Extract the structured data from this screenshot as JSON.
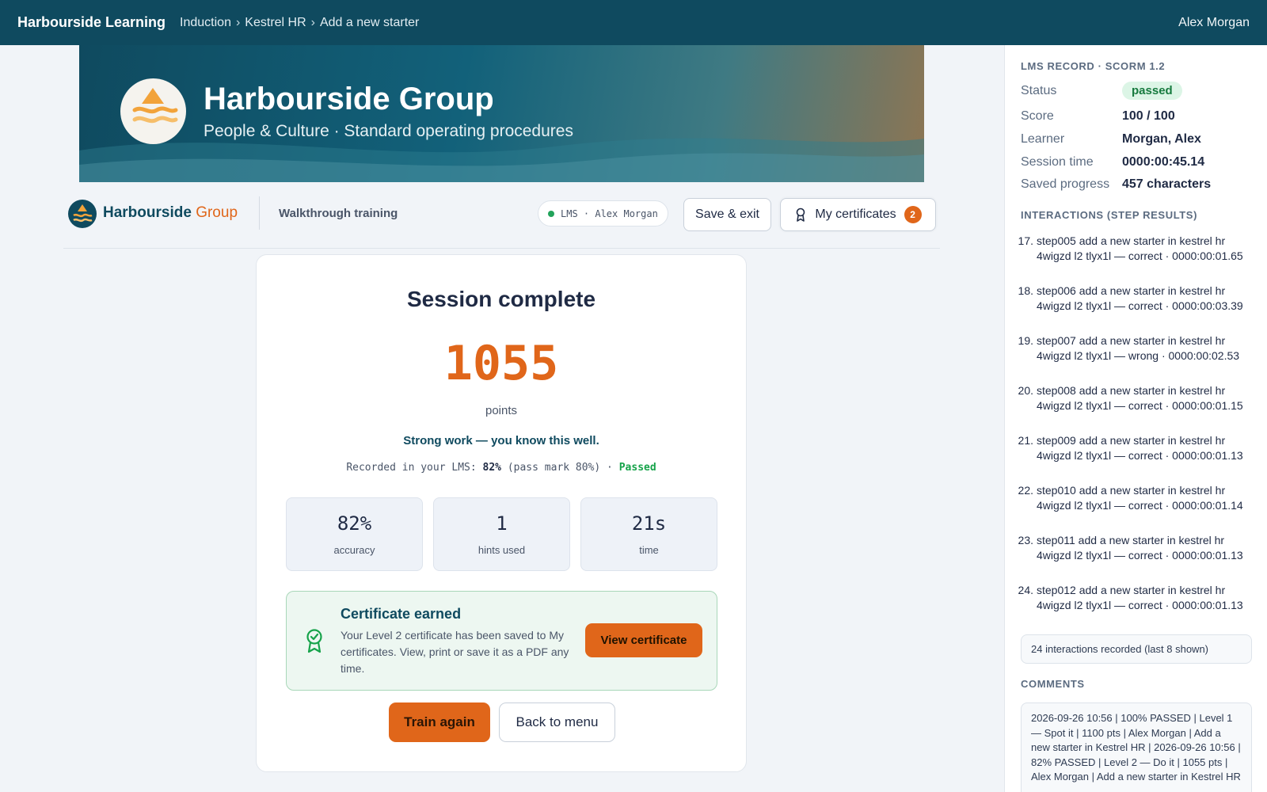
{
  "topbar": {
    "brand": "Harbourside Learning",
    "crumbs": [
      "Induction",
      "Kestrel HR",
      "Add a new starter"
    ],
    "separator": "›",
    "user": "Alex Morgan"
  },
  "hero": {
    "title": "Harbourside Group",
    "subtitle": "People & Culture · Standard operating procedures"
  },
  "apphead": {
    "brand_main": "Harbourside",
    "brand_accent": "Group",
    "section": "Walkthrough training",
    "lms_pill": "LMS · Alex Morgan",
    "save_label": "Save & exit",
    "certs_label": "My certificates",
    "certs_count": "2"
  },
  "session": {
    "heading": "Session complete",
    "points": "1055",
    "points_label": "points",
    "praise": "Strong work — you know this well.",
    "recorded_prefix": "Recorded in your LMS:",
    "recorded_score": "82%",
    "recorded_passmark": "(pass mark 80%) ·",
    "recorded_status": "Passed",
    "stats": [
      {
        "value": "82%",
        "label": "accuracy"
      },
      {
        "value": "1",
        "label": "hints used"
      },
      {
        "value": "21s",
        "label": "time"
      }
    ],
    "certificate": {
      "title": "Certificate earned",
      "text": "Your Level 2 certificate has been saved to My certificates. View, print or save it as a PDF any time.",
      "button": "View certificate"
    },
    "train_again": "Train again",
    "back_to_menu": "Back to menu"
  },
  "lms": {
    "heading": "LMS RECORD · SCORM 1.2",
    "status_label": "Status",
    "status": "passed",
    "score_label": "Score",
    "score": "100 / 100",
    "learner_label": "Learner",
    "learner": "Morgan, Alex",
    "session_time_label": "Session time",
    "session_time": "0000:00:45.14",
    "saved_label": "Saved progress",
    "saved": "457 characters",
    "interactions_heading": "INTERACTIONS (STEP RESULTS)",
    "interactions": [
      {
        "num": "17.",
        "text": "step005 add a new starter in kestrel hr 4wigzd l2 tlyx1l — correct · 0000:00:01.65"
      },
      {
        "num": "18.",
        "text": "step006 add a new starter in kestrel hr 4wigzd l2 tlyx1l — correct · 0000:00:03.39"
      },
      {
        "num": "19.",
        "text": "step007 add a new starter in kestrel hr 4wigzd l2 tlyx1l — wrong · 0000:00:02.53"
      },
      {
        "num": "20.",
        "text": "step008 add a new starter in kestrel hr 4wigzd l2 tlyx1l — correct · 0000:00:01.15"
      },
      {
        "num": "21.",
        "text": "step009 add a new starter in kestrel hr 4wigzd l2 tlyx1l — correct · 0000:00:01.13"
      },
      {
        "num": "22.",
        "text": "step010 add a new starter in kestrel hr 4wigzd l2 tlyx1l — correct · 0000:00:01.14"
      },
      {
        "num": "23.",
        "text": "step011 add a new starter in kestrel hr 4wigzd l2 tlyx1l — correct · 0000:00:01.13"
      },
      {
        "num": "24.",
        "text": "step012 add a new starter in kestrel hr 4wigzd l2 tlyx1l — correct · 0000:00:01.13"
      }
    ],
    "interactions_summary": "24 interactions recorded (last 8 shown)",
    "comments_heading": "COMMENTS",
    "comments": "2026-09-26 10:56 | 100% PASSED | Level 1 — Spot it | 1100 pts | Alex Morgan | Add a new starter in Kestrel HR | 2026-09-26 10:56 | 82% PASSED | Level 2 — Do it | 1055 pts | Alex Morgan | Add a new starter in Kestrel HR"
  },
  "colors": {
    "brand": "#0f4a5f",
    "accent": "#e0661a",
    "success": "#16a34a"
  },
  "icons": {
    "certificates": "award-icon",
    "certificate_earned": "award-check-icon",
    "lms_status": "status-dot-icon"
  }
}
